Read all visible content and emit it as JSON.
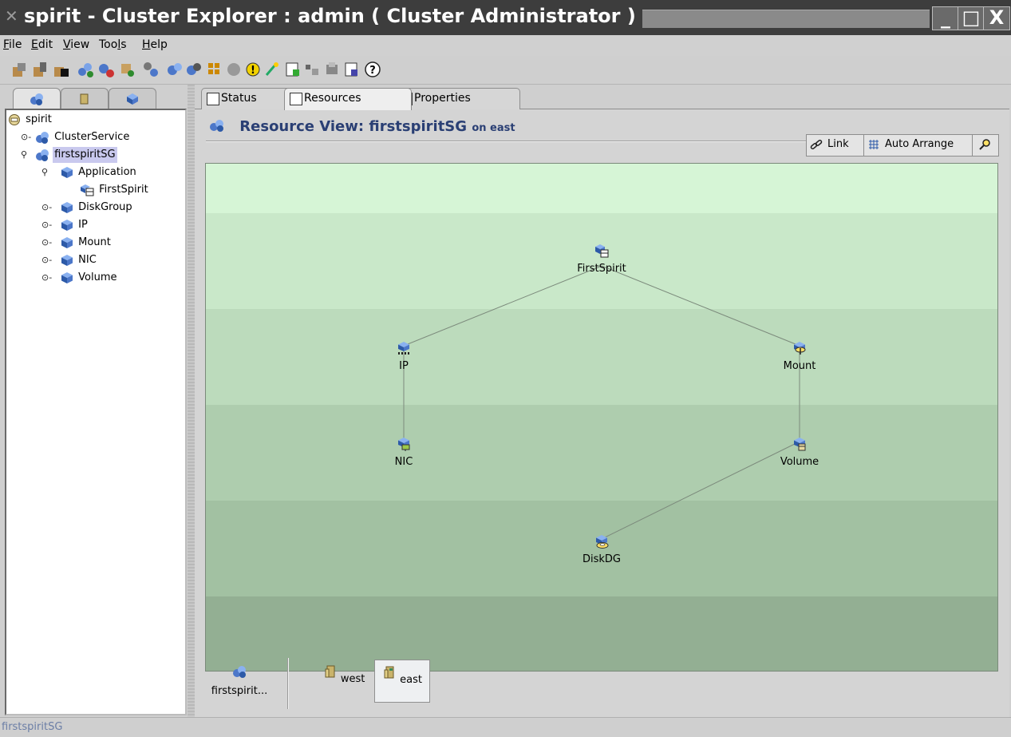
{
  "window": {
    "title": "spirit - Cluster Explorer : admin ( Cluster Administrator )",
    "min_label": "_",
    "max_label": "□",
    "close_label": "X"
  },
  "menu": [
    {
      "label": "File",
      "mnemonic": "F"
    },
    {
      "label": "Edit",
      "mnemonic": "E"
    },
    {
      "label": "View",
      "mnemonic": "V"
    },
    {
      "label": "Tools",
      "mnemonic": "l"
    },
    {
      "label": "Help",
      "mnemonic": "H"
    }
  ],
  "toolbar_icons": [
    "add-cluster-icon",
    "open-configuration-icon",
    "save-configuration-icon",
    "add-service-group-icon",
    "delete-service-group-icon",
    "add-resource-icon",
    "link-resources-icon",
    "online-service-group-icon",
    "offline-service-group-icon",
    "show-command-center-icon",
    "stop-icon",
    "info-icon",
    "configuration-wizard-icon",
    "template-view-icon",
    "query-icon",
    "notifier-icon",
    "log-desk-icon",
    "help-icon"
  ],
  "left_tabs": [
    "service-groups-tab",
    "systems-tab",
    "resource-types-tab"
  ],
  "tree": {
    "root": "spirit",
    "items": [
      {
        "label": "ClusterService",
        "level": 1,
        "icon": "service-group-icon"
      },
      {
        "label": "firstspiritSG",
        "level": 1,
        "icon": "service-group-icon",
        "selected": true
      },
      {
        "label": "Application",
        "level": 2,
        "icon": "resource-type-icon"
      },
      {
        "label": "FirstSpirit",
        "level": 3,
        "icon": "application-resource-icon"
      },
      {
        "label": "DiskGroup",
        "level": 2,
        "icon": "resource-type-icon"
      },
      {
        "label": "IP",
        "level": 2,
        "icon": "resource-type-icon"
      },
      {
        "label": "Mount",
        "level": 2,
        "icon": "resource-type-icon"
      },
      {
        "label": "NIC",
        "level": 2,
        "icon": "resource-type-icon"
      },
      {
        "label": "Volume",
        "level": 2,
        "icon": "resource-type-icon"
      }
    ]
  },
  "tabs": [
    {
      "label": "Status",
      "selected": false
    },
    {
      "label": "Resources",
      "selected": true
    },
    {
      "label": "Properties",
      "selected": false
    }
  ],
  "view": {
    "title": "Resource View: firstspiritSG",
    "subtitle": "on east",
    "link_label": "Link",
    "auto_arrange_label": "Auto Arrange"
  },
  "colors": {
    "band1": "#d6f5d6",
    "band2": "#c9e8c9",
    "band3": "#bcdbbc",
    "band4": "#aecdae",
    "band5": "#a2c1a2",
    "band6": "#93af93",
    "title_text": "#2a3f74",
    "node_icon": "#3a8ed8",
    "selection": "#c9c9ee"
  },
  "resources": [
    {
      "id": "FirstSpirit",
      "label": "FirstSpirit",
      "icon": "application-resource-icon"
    },
    {
      "id": "IP",
      "label": "IP",
      "icon": "ip-resource-icon"
    },
    {
      "id": "Mount",
      "label": "Mount",
      "icon": "mount-resource-icon"
    },
    {
      "id": "NIC",
      "label": "NIC",
      "icon": "nic-resource-icon"
    },
    {
      "id": "Volume",
      "label": "Volume",
      "icon": "volume-resource-icon"
    },
    {
      "id": "DiskDG",
      "label": "DiskDG",
      "icon": "diskgroup-resource-icon"
    }
  ],
  "dependencies": [
    [
      "FirstSpirit",
      "IP"
    ],
    [
      "FirstSpirit",
      "Mount"
    ],
    [
      "IP",
      "NIC"
    ],
    [
      "Mount",
      "Volume"
    ],
    [
      "Volume",
      "DiskDG"
    ]
  ],
  "systems_bar": [
    {
      "label": "firstspirit...",
      "icon": "service-group-icon",
      "selected": false
    },
    {
      "label": "west",
      "icon": "system-icon",
      "selected": false
    },
    {
      "label": "east",
      "icon": "system-icon",
      "selected": true
    }
  ],
  "status": "firstspiritSG"
}
